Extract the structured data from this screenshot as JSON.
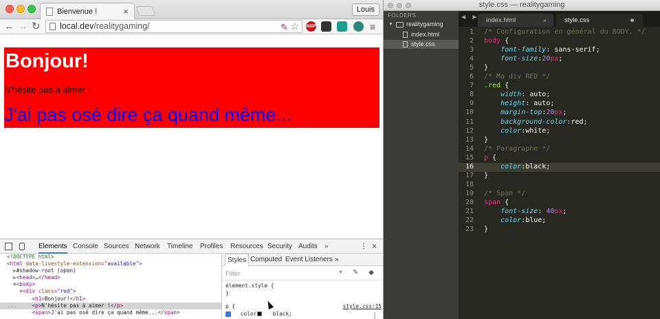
{
  "chrome": {
    "tab_title": "Bienvenue !",
    "tab_close": "×",
    "profile_name": "Louis",
    "nav": {
      "back": "←",
      "forward": "→",
      "reload": "↻"
    },
    "url_host": "local.dev",
    "url_path": "/realitygaming/",
    "extensions": [
      "ABP",
      "",
      "",
      ""
    ],
    "menu_icon": "≡"
  },
  "page": {
    "h1": "Bonjour!",
    "p": "N'hésite pas à aimer !",
    "span": "J'ai pas osé dire ça quand même..."
  },
  "devtools": {
    "tabs": [
      "Elements",
      "Console",
      "Sources",
      "Network",
      "Timeline",
      "Profiles",
      "Resources",
      "Security",
      "Audits"
    ],
    "more": "»",
    "menu": "⋮",
    "close": "×",
    "elements": [
      {
        "segments": [
          {
            "t": "<!DOCTYPE html>",
            "c": "el-comment"
          }
        ]
      },
      {
        "segments": [
          {
            "t": "<html ",
            "c": "el-tag"
          },
          {
            "t": "data-livestyle-extension",
            "c": "el-attr"
          },
          {
            "t": "=\"",
            "c": "el-tag"
          },
          {
            "t": "available",
            "c": "el-val"
          },
          {
            "t": "\">",
            "c": "el-tag"
          }
        ]
      },
      {
        "segments": [
          {
            "t": "  ▶",
            "c": "el-dim"
          },
          {
            "t": "#shadow-root (open)",
            "c": "el-text"
          }
        ]
      },
      {
        "segments": [
          {
            "t": "  ▶",
            "c": "el-dim"
          },
          {
            "t": "<head>",
            "c": "el-tag"
          },
          {
            "t": "…",
            "c": "el-text"
          },
          {
            "t": "</head>",
            "c": "el-tag"
          }
        ]
      },
      {
        "segments": [
          {
            "t": "  ▼",
            "c": "el-dim"
          },
          {
            "t": "<body>",
            "c": "el-tag"
          }
        ]
      },
      {
        "segments": [
          {
            "t": "    ▼",
            "c": "el-dim"
          },
          {
            "t": "<div ",
            "c": "el-tag"
          },
          {
            "t": "class",
            "c": "el-attr"
          },
          {
            "t": "=\"",
            "c": "el-tag"
          },
          {
            "t": "red",
            "c": "el-val"
          },
          {
            "t": "\">",
            "c": "el-tag"
          }
        ]
      },
      {
        "segments": [
          {
            "t": "        <h1>",
            "c": "el-tag"
          },
          {
            "t": "Bonjour!",
            "c": "el-text"
          },
          {
            "t": "</h1>",
            "c": "el-tag"
          }
        ]
      },
      {
        "segments": [
          {
            "t": "...     ",
            "c": "el-dim"
          },
          {
            "t": "<p>",
            "c": "el-tag"
          },
          {
            "t": "N'hésite pas à aimer !",
            "c": "el-text"
          },
          {
            "t": "</p>",
            "c": "el-tag"
          }
        ],
        "sel": true
      },
      {
        "segments": [
          {
            "t": "        <span>",
            "c": "el-tag"
          },
          {
            "t": "J'ai pas osé dire ça quand même...",
            "c": "el-text"
          },
          {
            "t": "</span>",
            "c": "el-tag"
          }
        ]
      }
    ],
    "styles_tabs": [
      "Styles",
      "Computed",
      "Event Listeners"
    ],
    "styles_more": "»",
    "filter_placeholder": "Filter",
    "styles_icons": "+ ✎ ◆",
    "element_style": "element.style {",
    "element_style_close": "}",
    "rule_selector": "p {",
    "rule_source": "style.css:15",
    "rule_decl": "    color:    black;",
    "rule_close": "}",
    "kebab": "⋮"
  },
  "sublime": {
    "window_title": "style.css — realitygaming",
    "folders_label": "FOLDERS",
    "project_folder": "realitygaming",
    "files": [
      "index.html",
      "style.css"
    ],
    "selected_file": "style.css",
    "tab_arrows": "◀ ▶",
    "tabs": [
      {
        "label": "index.html",
        "close": "×"
      },
      {
        "label": "style.css",
        "close": ""
      }
    ],
    "current_line": 16,
    "code_lines": [
      [
        {
          "t": "/* Configuration en général du BODY. */",
          "c": "c-com"
        }
      ],
      [
        {
          "t": "body",
          "c": "c-tag"
        },
        {
          "t": " {",
          "c": "c-pun"
        }
      ],
      [
        {
          "t": "    ",
          "c": "c-pun"
        },
        {
          "t": "font-family",
          "c": "c-prop"
        },
        {
          "t": ": sans-serif;",
          "c": "c-pun"
        }
      ],
      [
        {
          "t": "    ",
          "c": "c-pun"
        },
        {
          "t": "font-size",
          "c": "c-prop"
        },
        {
          "t": ":",
          "c": "c-pun"
        },
        {
          "t": "20",
          "c": "c-num"
        },
        {
          "t": "px",
          "c": "c-unit"
        },
        {
          "t": ";",
          "c": "c-pun"
        }
      ],
      [
        {
          "t": "}",
          "c": "c-pun"
        }
      ],
      [
        {
          "t": "/* Ma div RED */",
          "c": "c-com"
        }
      ],
      [
        {
          "t": ".red",
          "c": "c-cls"
        },
        {
          "t": " {",
          "c": "c-pun"
        }
      ],
      [
        {
          "t": "    ",
          "c": "c-pun"
        },
        {
          "t": "width",
          "c": "c-prop"
        },
        {
          "t": ": auto;",
          "c": "c-pun"
        }
      ],
      [
        {
          "t": "    ",
          "c": "c-pun"
        },
        {
          "t": "height",
          "c": "c-prop"
        },
        {
          "t": ": auto;",
          "c": "c-pun"
        }
      ],
      [
        {
          "t": "    ",
          "c": "c-pun"
        },
        {
          "t": "margin-top",
          "c": "c-prop"
        },
        {
          "t": ":",
          "c": "c-pun"
        },
        {
          "t": "20",
          "c": "c-num"
        },
        {
          "t": "px",
          "c": "c-unit"
        },
        {
          "t": ";",
          "c": "c-pun"
        }
      ],
      [
        {
          "t": "    ",
          "c": "c-pun"
        },
        {
          "t": "background-color",
          "c": "c-prop"
        },
        {
          "t": ":red;",
          "c": "c-pun"
        }
      ],
      [
        {
          "t": "    ",
          "c": "c-pun"
        },
        {
          "t": "color",
          "c": "c-prop"
        },
        {
          "t": ":white;",
          "c": "c-pun"
        }
      ],
      [
        {
          "t": "}",
          "c": "c-pun"
        }
      ],
      [
        {
          "t": "/* Paragraphe */",
          "c": "c-com"
        }
      ],
      [
        {
          "t": "p",
          "c": "c-tag"
        },
        {
          "t": " {",
          "c": "c-pun"
        }
      ],
      [
        {
          "t": "    ",
          "c": "c-pun"
        },
        {
          "t": "color",
          "c": "c-prop"
        },
        {
          "t": ":black;",
          "c": "c-pun"
        }
      ],
      [
        {
          "t": "}",
          "c": "c-pun"
        }
      ],
      [
        {
          "t": "",
          "c": "c-pun"
        }
      ],
      [
        {
          "t": "/* Span */",
          "c": "c-com"
        }
      ],
      [
        {
          "t": "span",
          "c": "c-tag"
        },
        {
          "t": " {",
          "c": "c-pun"
        }
      ],
      [
        {
          "t": "    ",
          "c": "c-pun"
        },
        {
          "t": "font-size",
          "c": "c-prop"
        },
        {
          "t": ": ",
          "c": "c-pun"
        },
        {
          "t": "40",
          "c": "c-num"
        },
        {
          "t": "px",
          "c": "c-unit"
        },
        {
          "t": ";",
          "c": "c-pun"
        }
      ],
      [
        {
          "t": "    ",
          "c": "c-pun"
        },
        {
          "t": "color",
          "c": "c-prop"
        },
        {
          "t": ":blue;",
          "c": "c-pun"
        }
      ],
      [
        {
          "t": "}",
          "c": "c-pun"
        }
      ]
    ]
  },
  "colors": {
    "red_div": "#ff0000",
    "span_blue": "#0000ff",
    "monokai_bg": "#272822",
    "devtools_accent": "#3879d9"
  }
}
